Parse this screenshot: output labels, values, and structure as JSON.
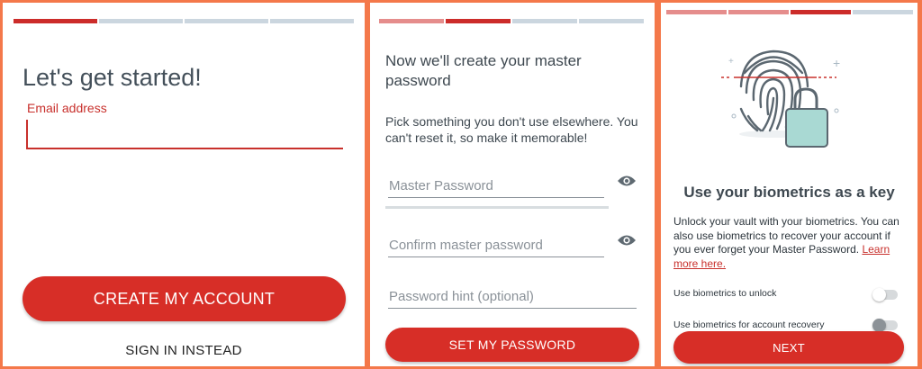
{
  "screen1": {
    "title": "Let's get started!",
    "email_label": "Email address",
    "email_value": "",
    "create_button": "CREATE MY ACCOUNT",
    "sign_in_link": "SIGN IN INSTEAD",
    "progress_step": 1,
    "progress_total": 4
  },
  "screen2": {
    "title": "Now we'll create your master password",
    "description": "Pick something you don't use elsewhere. You can't reset it, so make it memorable!",
    "master_password_placeholder": "Master Password",
    "confirm_password_placeholder": "Confirm master password",
    "hint_placeholder": "Password hint (optional)",
    "set_button": "SET MY PASSWORD",
    "progress_step": 2,
    "progress_total": 4
  },
  "screen3": {
    "title": "Use your biometrics as a key",
    "description": "Unlock your vault with your biometrics. You can also use biometrics to recover your account if you ever forget your Master Password.",
    "learn_more": "Learn more here.",
    "toggle_unlock_label": "Use biometrics to unlock",
    "toggle_unlock_on": false,
    "toggle_recovery_label": "Use biometrics for account recovery",
    "toggle_recovery_on": false,
    "next_button": "NEXT",
    "progress_step": 3,
    "progress_total": 4
  },
  "colors": {
    "accent": "#d72e27",
    "frame": "#f4784a",
    "progress_inactive": "#cbd6df",
    "progress_done": "#e58d8c"
  },
  "icons": [
    "eye-icon",
    "fingerprint-lock-illustration"
  ]
}
